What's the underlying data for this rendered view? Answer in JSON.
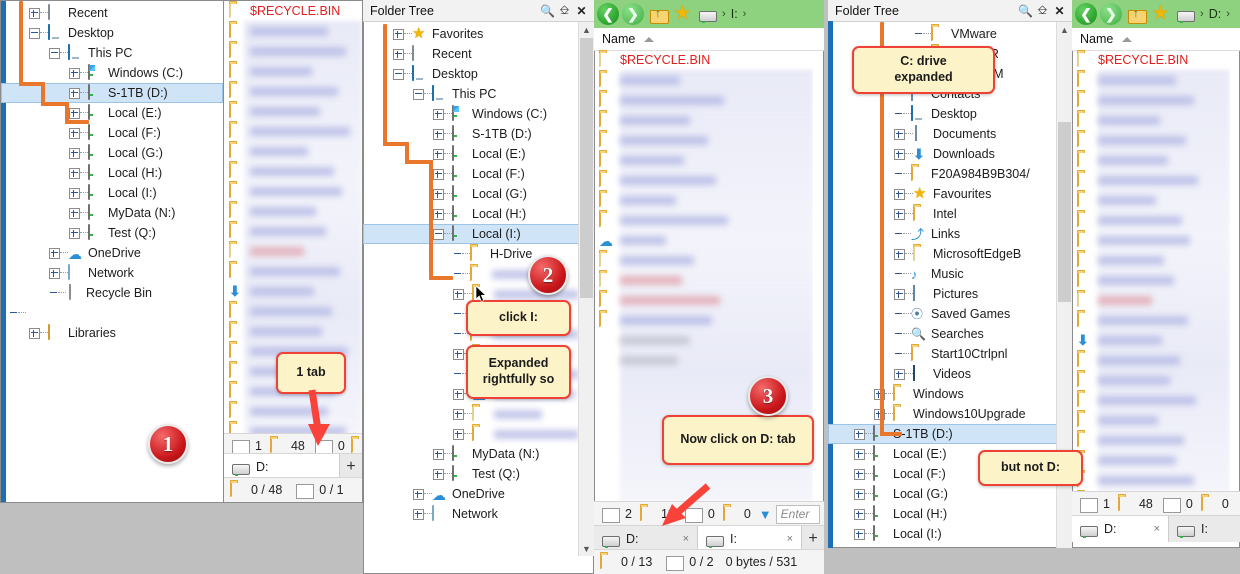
{
  "colors": {
    "accent_blue": "#1c6fb5",
    "tree_line_orange": "#e8762c",
    "selection_blue": "#cfe4f7",
    "callout_fill": "#fdf3c8",
    "callout_border": "#ef4136",
    "badge_red": "#c9161a",
    "toolbar_green": "#8ed17f",
    "recycle_red_text": "#e02020"
  },
  "panel1_tree": {
    "items": [
      {
        "label": "Recent",
        "icon": "recent-icon",
        "expander": "plus",
        "indent": 1
      },
      {
        "label": "Desktop",
        "icon": "monitor-icon",
        "expander": "minus",
        "indent": 1
      },
      {
        "label": "This PC",
        "icon": "monitor-icon",
        "expander": "minus",
        "indent": 2
      },
      {
        "label": "Windows (C:)",
        "icon": "drive-windows-icon",
        "expander": "plus",
        "indent": 3
      },
      {
        "label": "S-1TB (D:)",
        "icon": "drive-icon",
        "expander": "plus",
        "indent": 3,
        "selected": true
      },
      {
        "label": "Local (E:)",
        "icon": "drive-icon",
        "expander": "plus",
        "indent": 3
      },
      {
        "label": "Local (F:)",
        "icon": "drive-icon",
        "expander": "plus",
        "indent": 3
      },
      {
        "label": "Local (G:)",
        "icon": "drive-icon",
        "expander": "plus",
        "indent": 3
      },
      {
        "label": "Local (H:)",
        "icon": "drive-icon",
        "expander": "plus",
        "indent": 3
      },
      {
        "label": "Local (I:)",
        "icon": "drive-icon",
        "expander": "plus",
        "indent": 3
      },
      {
        "label": "MyData (N:)",
        "icon": "drive-icon",
        "expander": "plus",
        "indent": 3
      },
      {
        "label": "Test (Q:)",
        "icon": "drive-icon",
        "expander": "plus",
        "indent": 3
      },
      {
        "label": "OneDrive",
        "icon": "cloud-icon",
        "expander": "plus",
        "indent": 2
      },
      {
        "label": "Network",
        "icon": "network-icon",
        "expander": "plus",
        "indent": 2
      },
      {
        "label": "Recycle Bin",
        "icon": "recycle-bin-icon",
        "expander": "none",
        "indent": 2
      },
      {
        "label": "",
        "icon": "",
        "expander": "none",
        "indent": 0
      },
      {
        "label": "Libraries",
        "icon": "library-icon",
        "expander": "plus",
        "indent": 1
      }
    ]
  },
  "panel1_list": {
    "first_item": "$RECYCLE.BIN",
    "status": {
      "files_icon": "file-icon",
      "files": "1",
      "folders_icon": "folder-icon",
      "folders": "48",
      "sel_files": "0"
    },
    "tab": {
      "label": "D:",
      "icon": "drive-icon",
      "plus": "+"
    },
    "bottom": {
      "folders_sel": "0 / 48",
      "files_sel": "0 / 1"
    }
  },
  "panel2_tree": {
    "title": "Folder Tree",
    "header_icons": [
      "search-icon",
      "unpin-icon",
      "close-icon"
    ],
    "items": [
      {
        "label": "Favorites",
        "icon": "star-icon",
        "expander": "plus",
        "indent": 1
      },
      {
        "label": "Recent",
        "icon": "recent-icon",
        "expander": "plus",
        "indent": 1
      },
      {
        "label": "Desktop",
        "icon": "monitor-icon",
        "expander": "minus",
        "indent": 1
      },
      {
        "label": "This PC",
        "icon": "monitor-icon",
        "expander": "minus",
        "indent": 2
      },
      {
        "label": "Windows (C:)",
        "icon": "drive-windows-icon",
        "expander": "plus",
        "indent": 3
      },
      {
        "label": "S-1TB (D:)",
        "icon": "drive-icon",
        "expander": "plus",
        "indent": 3
      },
      {
        "label": "Local (E:)",
        "icon": "drive-icon",
        "expander": "plus",
        "indent": 3
      },
      {
        "label": "Local (F:)",
        "icon": "drive-icon",
        "expander": "plus",
        "indent": 3
      },
      {
        "label": "Local (G:)",
        "icon": "drive-icon",
        "expander": "plus",
        "indent": 3
      },
      {
        "label": "Local (H:)",
        "icon": "drive-icon",
        "expander": "plus",
        "indent": 3
      },
      {
        "label": "Local (I:)",
        "icon": "drive-icon",
        "expander": "minus",
        "indent": 3,
        "selected": true
      },
      {
        "label": "H-Drive",
        "icon": "folder-icon",
        "expander": "none",
        "indent": 4
      },
      {
        "label": "",
        "icon": "folder-icon",
        "expander": "none",
        "indent": 4,
        "blurred": true
      },
      {
        "label": "",
        "icon": "folder-icon",
        "expander": "plus",
        "indent": 4,
        "blurred": true
      },
      {
        "label": "",
        "icon": "folder-icon",
        "expander": "none",
        "indent": 4,
        "blurred": true
      },
      {
        "label": "",
        "icon": "folder-icon",
        "expander": "none",
        "indent": 4,
        "blurred": true
      },
      {
        "label": "",
        "icon": "folder-icon",
        "expander": "plus",
        "indent": 4,
        "blurred": true
      },
      {
        "label": "",
        "icon": "folder-icon",
        "expander": "none",
        "indent": 4,
        "blurred": true
      },
      {
        "label": "",
        "icon": "cloud-icon",
        "expander": "plus",
        "indent": 4,
        "blurred": true
      },
      {
        "label": "",
        "icon": "folder-pale-icon",
        "expander": "plus",
        "indent": 4,
        "blurred": true
      },
      {
        "label": "",
        "icon": "folder-icon",
        "expander": "plus",
        "indent": 4,
        "blurred": true
      },
      {
        "label": "MyData (N:)",
        "icon": "drive-icon",
        "expander": "plus",
        "indent": 3
      },
      {
        "label": "Test (Q:)",
        "icon": "drive-icon",
        "expander": "plus",
        "indent": 3
      },
      {
        "label": "OneDrive",
        "icon": "cloud-icon",
        "expander": "plus",
        "indent": 2
      },
      {
        "label": "Network",
        "icon": "network-icon",
        "expander": "plus",
        "indent": 2
      }
    ]
  },
  "panel3_list": {
    "breadcrumb": {
      "drive_icon": "drive-icon",
      "sep1": "›",
      "drive": "I:",
      "sep2": "›"
    },
    "nav": {
      "back": "←",
      "forward": "→",
      "up_folder_icon": "folder-up-icon",
      "favorites_icon": "star-icon"
    },
    "column_header": "Name",
    "sort_indicator": "ascending",
    "first_item": "$RECYCLE.BIN",
    "status": {
      "files": "2",
      "folders": "13",
      "sel_files": "0",
      "sel_folders": "0",
      "filter_icon": "funnel-icon",
      "filter_placeholder": "Enter"
    },
    "tabs": [
      {
        "label": "D:",
        "icon": "drive-icon",
        "active": false,
        "close": "×"
      },
      {
        "label": "I:",
        "icon": "drive-icon",
        "active": true,
        "close": "×"
      }
    ],
    "tab_add": "+",
    "bottom": {
      "folders_sel": "0 / 13",
      "files_sel": "0 / 2",
      "size": "0 bytes / 531"
    }
  },
  "panel4_tree": {
    "title": "Folder Tree",
    "header_icons": [
      "search-icon",
      "unpin-icon",
      "close-icon"
    ],
    "items": [
      {
        "label": "VMware",
        "icon": "folder-icon",
        "expander": "none",
        "indent": 4
      },
      {
        "label": "WinRAR",
        "icon": "folder-icon",
        "expander": "none",
        "indent": 4
      },
      {
        "label": "XnViewM",
        "icon": "folder-icon",
        "expander": "none",
        "indent": 4
      },
      {
        "label": "Contacts",
        "icon": "contacts-icon",
        "expander": "none",
        "indent": 3
      },
      {
        "label": "Desktop",
        "icon": "monitor-icon",
        "expander": "none",
        "indent": 3
      },
      {
        "label": "Documents",
        "icon": "documents-icon",
        "expander": "plus",
        "indent": 3
      },
      {
        "label": "Downloads",
        "icon": "download-icon",
        "expander": "plus",
        "indent": 3
      },
      {
        "label": "F20A984B9B304/",
        "icon": "folder-icon",
        "expander": "none",
        "indent": 3
      },
      {
        "label": "Favourites",
        "icon": "star-icon",
        "expander": "plus",
        "indent": 3
      },
      {
        "label": "Intel",
        "icon": "folder-icon",
        "expander": "plus",
        "indent": 3
      },
      {
        "label": "Links",
        "icon": "links-icon",
        "expander": "none",
        "indent": 3
      },
      {
        "label": "MicrosoftEdgeB",
        "icon": "folder-pale-icon",
        "expander": "plus",
        "indent": 3
      },
      {
        "label": "Music",
        "icon": "music-icon",
        "expander": "none",
        "indent": 3
      },
      {
        "label": "Pictures",
        "icon": "pictures-icon",
        "expander": "plus",
        "indent": 3
      },
      {
        "label": "Saved Games",
        "icon": "saved-games-icon",
        "expander": "none",
        "indent": 3
      },
      {
        "label": "Searches",
        "icon": "searches-icon",
        "expander": "none",
        "indent": 3
      },
      {
        "label": "Start10Ctrlpnl",
        "icon": "folder-icon",
        "expander": "none",
        "indent": 3
      },
      {
        "label": "Videos",
        "icon": "videos-icon",
        "expander": "plus",
        "indent": 3
      },
      {
        "label": "Windows",
        "icon": "folder-icon",
        "expander": "plus",
        "indent": 2
      },
      {
        "label": "Windows10Upgrade",
        "icon": "folder-icon",
        "expander": "plus",
        "indent": 2
      },
      {
        "label": "S-1TB (D:)",
        "icon": "drive-icon",
        "expander": "plus",
        "indent": 1,
        "selected": true
      },
      {
        "label": "Local (E:)",
        "icon": "drive-icon",
        "expander": "plus",
        "indent": 1
      },
      {
        "label": "Local (F:)",
        "icon": "drive-icon",
        "expander": "plus",
        "indent": 1
      },
      {
        "label": "Local (G:)",
        "icon": "drive-icon",
        "expander": "plus",
        "indent": 1
      },
      {
        "label": "Local (H:)",
        "icon": "drive-icon",
        "expander": "plus",
        "indent": 1
      },
      {
        "label": "Local (I:)",
        "icon": "drive-icon",
        "expander": "plus",
        "indent": 1
      }
    ]
  },
  "panel5_list": {
    "breadcrumb": {
      "drive_icon": "drive-icon",
      "sep1": "›",
      "drive": "D:",
      "sep2": "›"
    },
    "column_header": "Name",
    "first_item": "$RECYCLE.BIN",
    "status": {
      "files": "1",
      "folders": "48",
      "sel_files": "0",
      "sel_folders": "0"
    },
    "tabs": [
      {
        "label": "D:",
        "icon": "drive-icon",
        "active": true,
        "close": "×"
      },
      {
        "label": "I:",
        "icon": "drive-icon",
        "active": false
      }
    ]
  },
  "annotations": {
    "badge1": "1",
    "badge2": "2",
    "badge3": "3",
    "callout_1tab": "1 tab",
    "callout_click_i": "click I:",
    "callout_expanded": "Expanded\nrightfully so",
    "callout_now_click": "Now click on D: tab",
    "callout_c_drive": "C: drive\nexpanded",
    "callout_but_not_d": "but not D:"
  }
}
